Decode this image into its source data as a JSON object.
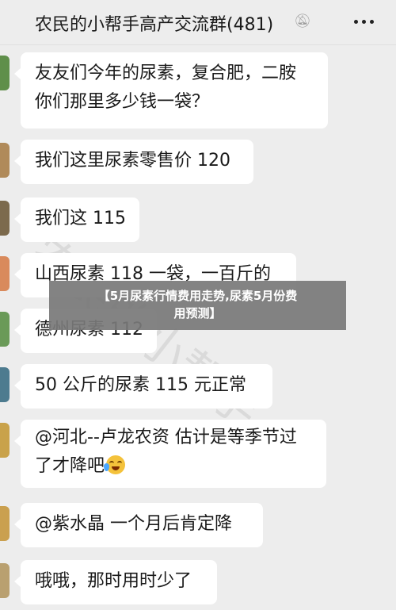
{
  "header": {
    "title": "农民的小帮手高产交流群(481)"
  },
  "messages": [
    {
      "lines": [
        "友友们今年的尿素，复合肥，二胺",
        "你们那里多少钱一袋？"
      ]
    },
    {
      "lines": [
        "我们这里尿素零售价 120"
      ]
    },
    {
      "lines": [
        "我们这 115"
      ]
    },
    {
      "lines": [
        "山西尿素 118 一袋，一百斤的"
      ]
    },
    {
      "lines": [
        "德州尿素 112"
      ]
    },
    {
      "lines": [
        "50 公斤的尿素 115 元正常"
      ]
    },
    {
      "lines": [
        "@河北--卢龙农资  估计是等季节过",
        "了才降吧"
      ]
    },
    {
      "lines": [
        "@紫水晶  一个月后肯定降"
      ]
    },
    {
      "lines": [
        "哦哦，那时用时少了"
      ]
    }
  ],
  "watermark": "农民的小帮手",
  "banner": {
    "line1": "【5月尿素行情费用走势,尿素5月份费",
    "line2": "用预测】"
  }
}
